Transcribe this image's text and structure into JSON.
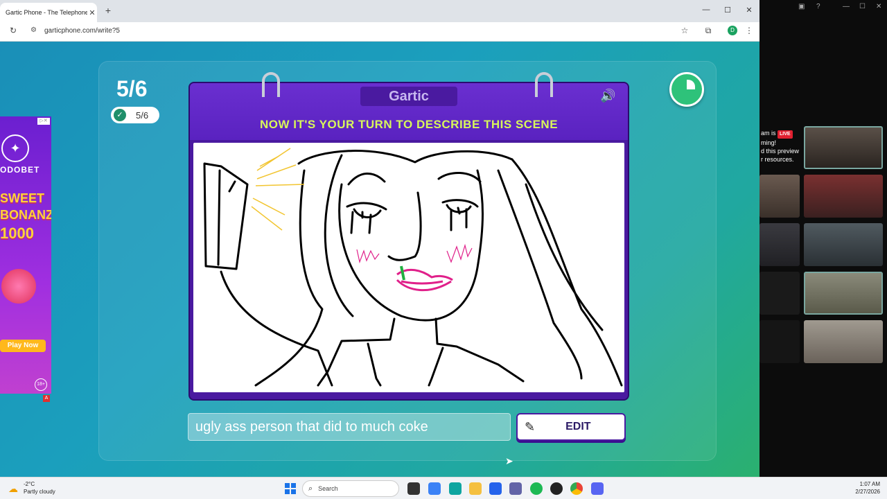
{
  "browser": {
    "tab_title": "Gartic Phone - The Telephone G",
    "tab_close": "✕",
    "new_tab": "+",
    "url": "garticphone.com/write?5",
    "profile_initial": "D",
    "window_controls": {
      "minimize": "—",
      "maximize": "☐",
      "close": "✕"
    }
  },
  "game": {
    "round": "5/6",
    "players_done": "5/6",
    "brand": "Gartic",
    "instruction": "NOW IT'S YOUR TURN TO DESCRIBE THIS SCENE",
    "description_value": "ugly ass person that did to much coke",
    "edit_label": "EDIT",
    "accent_color": "#5a22c0",
    "instruction_color": "#d8f75a"
  },
  "ad": {
    "brand": "ODOBET",
    "title_line1": "SWEET",
    "title_line2": "BONANZA",
    "title_line3": "1000",
    "cta": "Play Now",
    "age": "18+",
    "close": "▷✕"
  },
  "call": {
    "live_line1": "am is",
    "live_badge": "LIVE",
    "live_line2": "ming!",
    "live_line3": "d this preview",
    "live_line4": "r resources."
  },
  "taskbar": {
    "weather_temp": "-2°C",
    "weather_desc": "Partly cloudy",
    "search_label": "Search",
    "time": "1:07 AM",
    "date": "2/27/2026"
  }
}
